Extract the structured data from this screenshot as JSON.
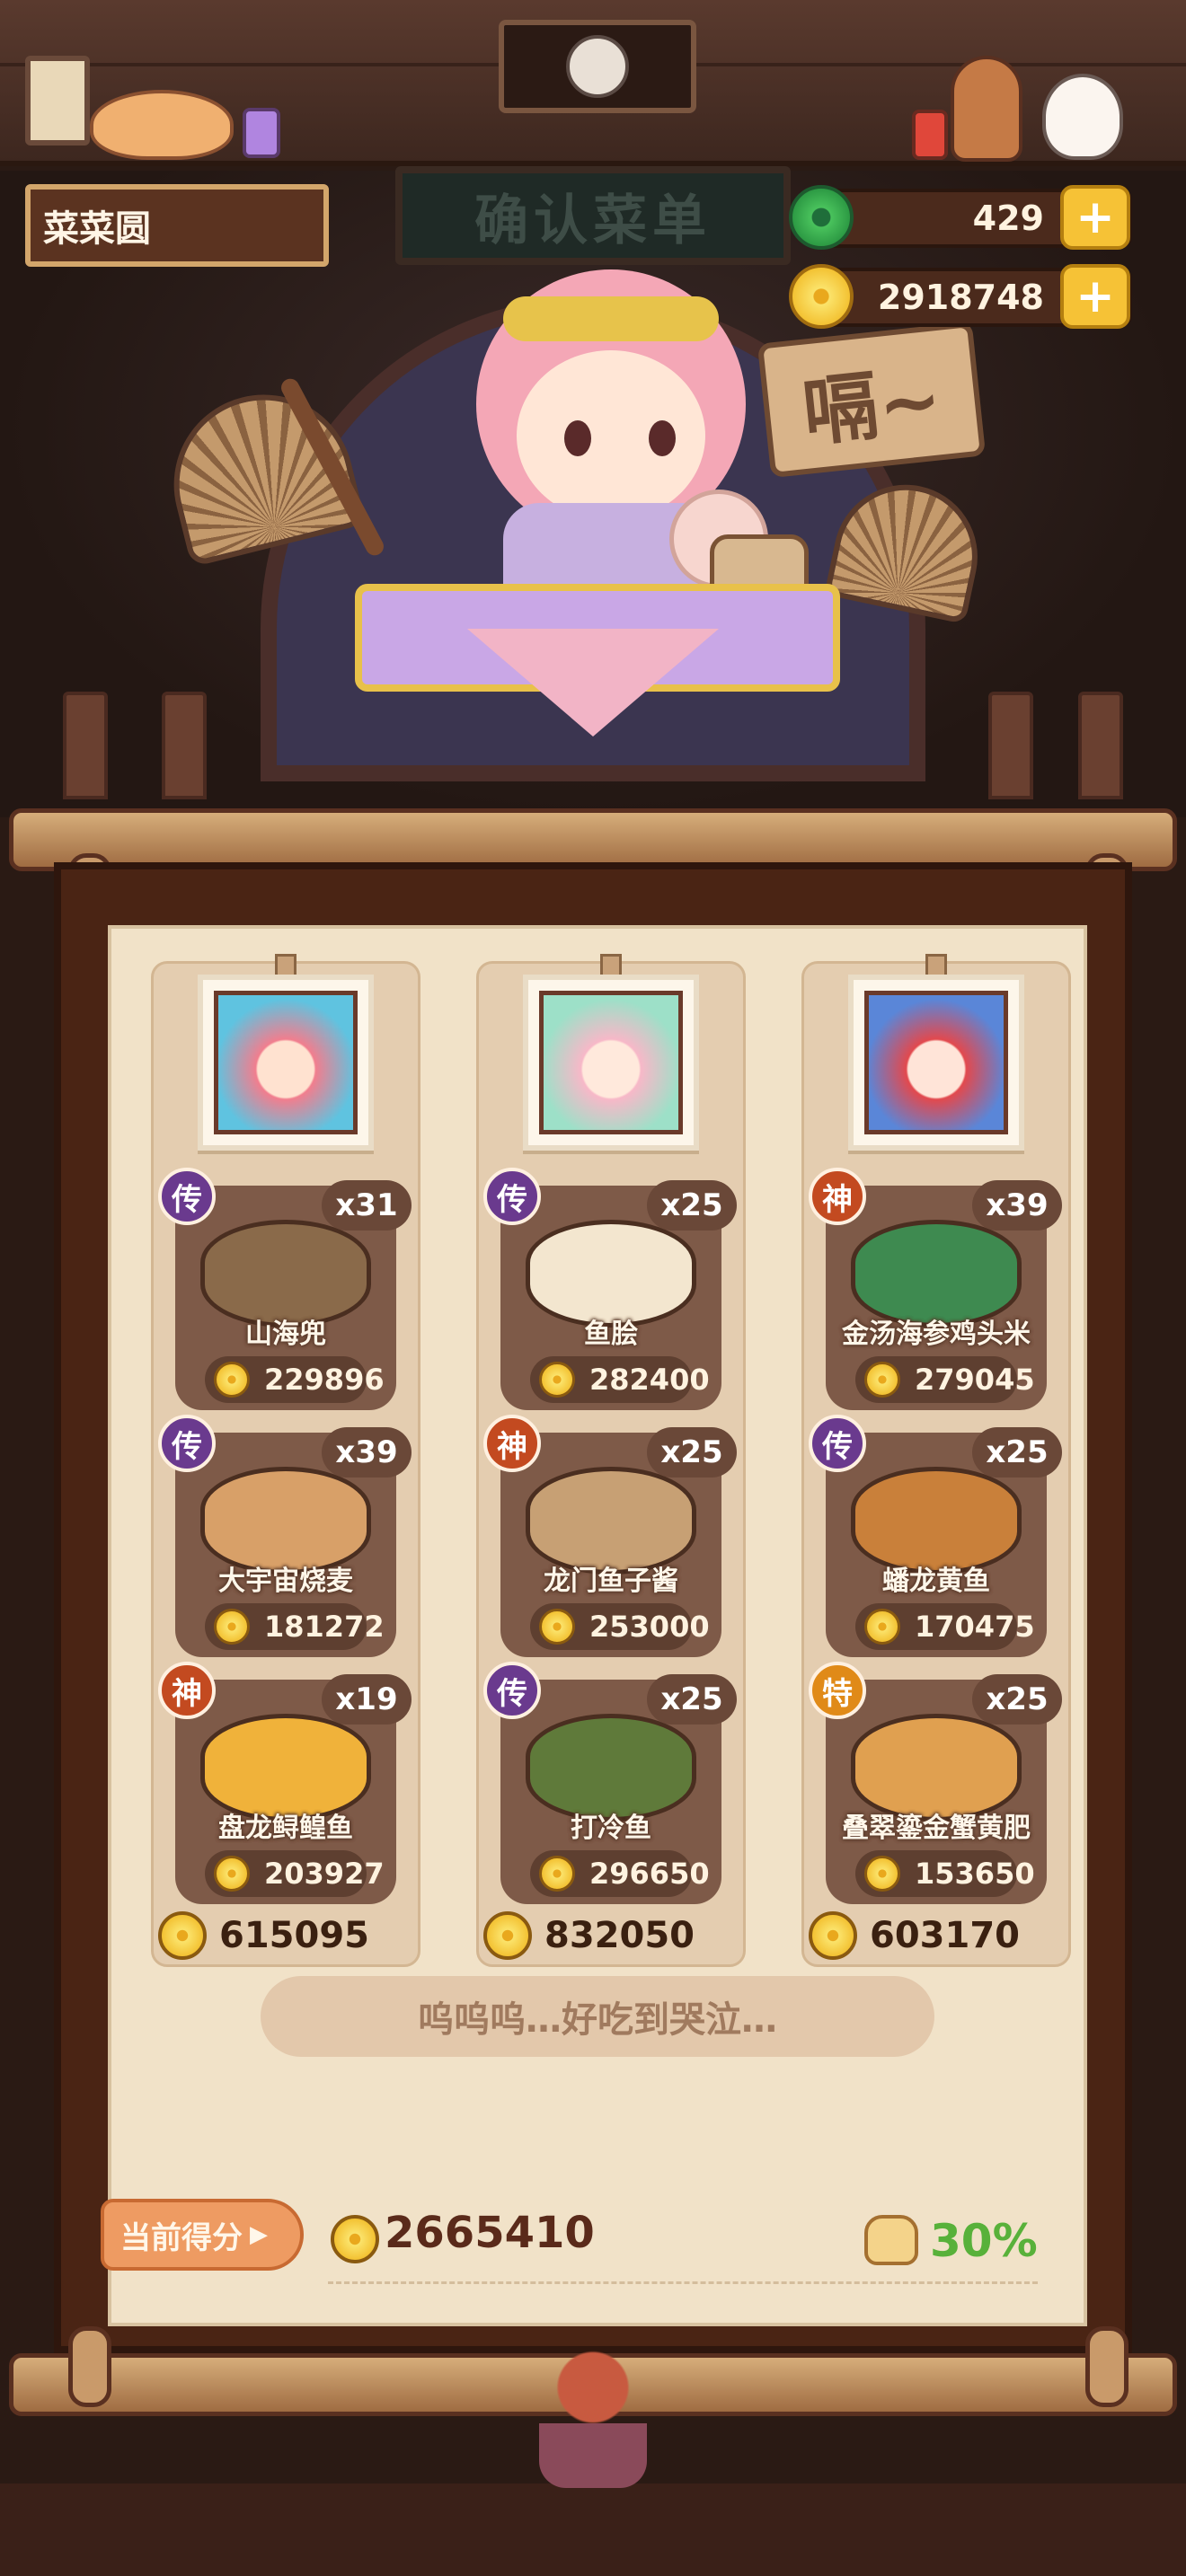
{
  "store": {
    "name": "菜菜圆"
  },
  "header": {
    "board_text": "确认菜单",
    "speech_text": "嗝~"
  },
  "currency": {
    "jade": {
      "icon": "jade-icon",
      "value": "429"
    },
    "coins": {
      "icon": "coin-icon",
      "value": "2918748"
    }
  },
  "columns": [
    {
      "portrait": "chef-portrait-1",
      "total": "615095",
      "dishes": [
        {
          "tier": "传",
          "qty": "x31",
          "name": "山海兜",
          "price": "229896"
        },
        {
          "tier": "传",
          "qty": "x39",
          "name": "大宇宙烧麦",
          "price": "181272"
        },
        {
          "tier": "神",
          "qty": "x19",
          "name": "盘龙鲟鳇鱼",
          "price": "203927"
        }
      ]
    },
    {
      "portrait": "chef-portrait-2",
      "total": "832050",
      "dishes": [
        {
          "tier": "传",
          "qty": "x25",
          "name": "鱼脍",
          "price": "282400"
        },
        {
          "tier": "神",
          "qty": "x25",
          "name": "龙门鱼子酱",
          "price": "253000"
        },
        {
          "tier": "传",
          "qty": "x25",
          "name": "打冷鱼",
          "price": "296650"
        }
      ]
    },
    {
      "portrait": "chef-portrait-3",
      "total": "603170",
      "dishes": [
        {
          "tier": "神",
          "qty": "x39",
          "name": "金汤海参鸡头米",
          "price": "279045"
        },
        {
          "tier": "传",
          "qty": "x25",
          "name": "蟠龙黄鱼",
          "price": "170475"
        },
        {
          "tier": "特",
          "qty": "x25",
          "name": "叠翠鎏金蟹黄肥",
          "price": "153650"
        }
      ]
    }
  ],
  "comment": "呜呜呜…好吃到哭泣…",
  "score": {
    "label": "当前得分",
    "value": "2665410",
    "bonus_percent": "30%"
  },
  "colors": {
    "tier_chuan": "#6a3a8e",
    "tier_shen": "#c34a20",
    "tier_te": "#e08a18",
    "bonus": "#58b13a"
  }
}
